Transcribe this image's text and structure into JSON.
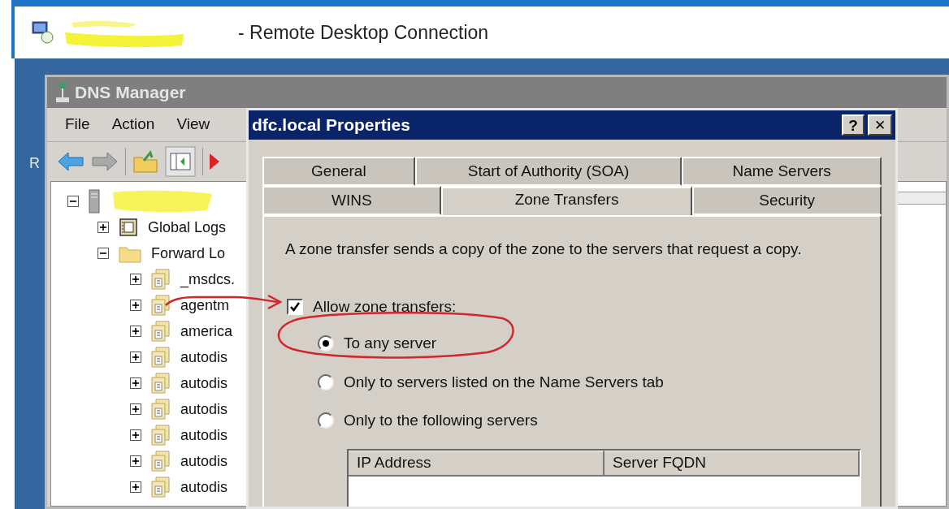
{
  "remote_window": {
    "title": "- Remote Desktop Connection"
  },
  "desktop": {
    "edge_text": "R"
  },
  "dns_manager": {
    "title": "DNS Manager",
    "menu": [
      "File",
      "Action",
      "View"
    ],
    "tree": [
      {
        "kind": "server",
        "expanded": true,
        "children": [
          {
            "kind": "logs",
            "label": "Global Logs",
            "expanded": false
          },
          {
            "kind": "folder",
            "label": "Forward Lo",
            "expanded": true,
            "children": [
              {
                "kind": "zone",
                "label": "_msdcs.",
                "expanded": false
              },
              {
                "kind": "zone",
                "label": "agentm",
                "expanded": false
              },
              {
                "kind": "zone",
                "label": "america",
                "expanded": false
              },
              {
                "kind": "zone",
                "label": "autodis",
                "expanded": false
              },
              {
                "kind": "zone",
                "label": "autodis",
                "expanded": false
              },
              {
                "kind": "zone",
                "label": "autodis",
                "expanded": false
              },
              {
                "kind": "zone",
                "label": "autodis",
                "expanded": false
              },
              {
                "kind": "zone",
                "label": "autodis",
                "expanded": false
              },
              {
                "kind": "zone",
                "label": "autodis",
                "expanded": false
              }
            ]
          }
        ]
      }
    ]
  },
  "dialog": {
    "title": "dfc.local Properties",
    "title_buttons": [
      {
        "kind": "help",
        "label": "?"
      },
      {
        "kind": "close",
        "label": "✕"
      }
    ],
    "tab_rows": [
      [
        {
          "label": "General",
          "selected": false
        },
        {
          "label": "Start of Authority (SOA)",
          "selected": false
        },
        {
          "label": "Name Servers",
          "selected": false
        }
      ],
      [
        {
          "label": "WINS",
          "selected": false
        },
        {
          "label": "Zone Transfers",
          "selected": true
        },
        {
          "label": "Security",
          "selected": false
        }
      ]
    ],
    "description": "A zone transfer sends a copy of the zone to the servers that request a copy.",
    "allow_checkbox": {
      "label": "Allow zone transfers:",
      "checked": true
    },
    "radios": [
      {
        "label": "To any server",
        "selected": true
      },
      {
        "label": "Only to servers listed on the Name Servers tab",
        "selected": false
      },
      {
        "label": "Only to the following servers",
        "selected": false
      }
    ],
    "table": {
      "columns": [
        "IP Address",
        "Server FQDN"
      ]
    }
  }
}
